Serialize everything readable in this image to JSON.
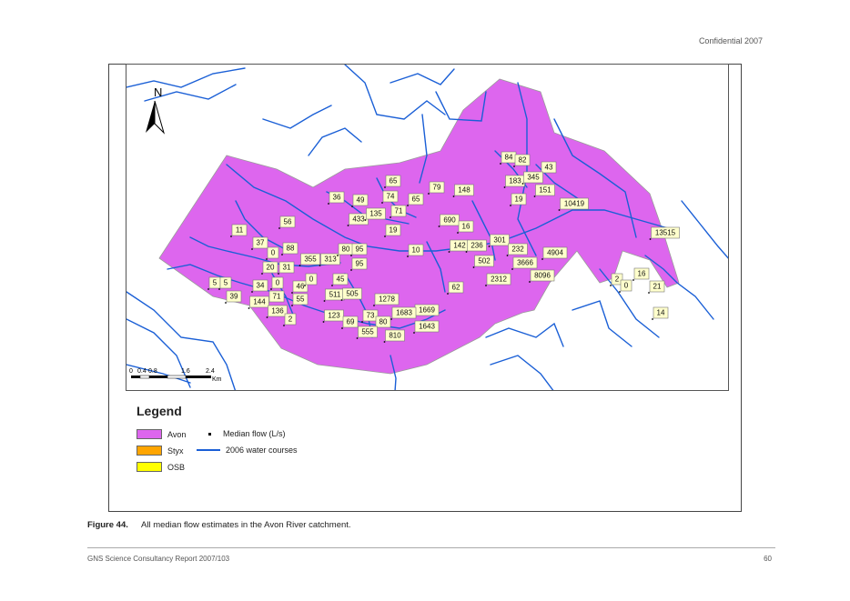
{
  "header": {
    "confidential": "Confidential 2007"
  },
  "map": {
    "north_label": "N",
    "scale_labels": [
      "0",
      "0.4",
      "0.8",
      "1.6",
      "2.4"
    ],
    "scale_unit": "Km",
    "flow_labels": [
      "84",
      "82",
      "43",
      "183",
      "345",
      "151",
      "19",
      "10419",
      "65",
      "79",
      "148",
      "36",
      "49",
      "74",
      "65",
      "433",
      "135",
      "71",
      "690",
      "16",
      "19",
      "56",
      "13515",
      "11",
      "142",
      "236",
      "301",
      "232",
      "4904",
      "10",
      "37",
      "0",
      "88",
      "313",
      "80",
      "95",
      "355",
      "502",
      "3666",
      "20",
      "31",
      "95",
      "2312",
      "8096",
      "5",
      "5",
      "34",
      "0",
      "46",
      "45",
      "2",
      "16",
      "0",
      "39",
      "71",
      "0",
      "511",
      "505",
      "1278",
      "62",
      "21",
      "144",
      "55",
      "136",
      "1669",
      "2",
      "123",
      "73",
      "1683",
      "69",
      "80",
      "1643",
      "555",
      "810",
      "14"
    ],
    "colors": {
      "avon": "#dd66ee",
      "water": "#1a5fd6"
    }
  },
  "legend": {
    "title": "Legend",
    "items": [
      {
        "label": "Avon",
        "color": "#dd66ee"
      },
      {
        "label": "Styx",
        "color": "#ffa500"
      },
      {
        "label": "OSB",
        "color": "#ffff00"
      }
    ],
    "median_flow": "Median flow (L/s)",
    "water_courses": "2006 water courses"
  },
  "caption": {
    "figure": "Figure 44.",
    "text": "All median flow estimates in the Avon River catchment."
  },
  "footer": {
    "left": "GNS Science Consultancy Report 2007/103",
    "page": "60"
  }
}
